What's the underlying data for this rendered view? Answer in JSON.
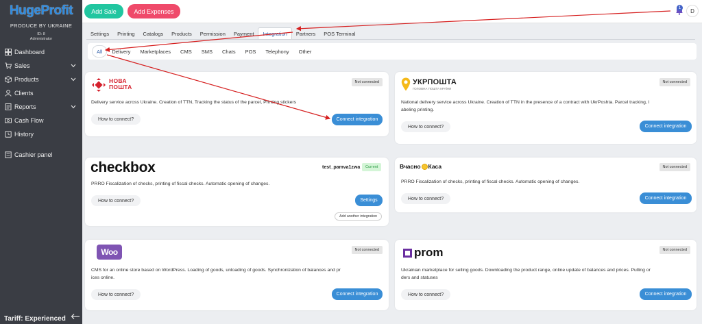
{
  "app": {
    "name": "HugeProfit",
    "tagline": "PRODUCE BY UKRAINE",
    "id_label": "ID: 8",
    "role": "Administrator",
    "tariff": "Tariff: Experienced"
  },
  "sidebar": {
    "items": [
      {
        "label": "Dashboard",
        "icon": "dashboard-icon"
      },
      {
        "label": "Sales",
        "icon": "cart-icon",
        "expandable": true
      },
      {
        "label": "Products",
        "icon": "box-icon",
        "expandable": true
      },
      {
        "label": "Clients",
        "icon": "user-icon"
      },
      {
        "label": "Reports",
        "icon": "report-icon",
        "expandable": true
      },
      {
        "label": "Cash Flow",
        "icon": "cashflow-icon"
      },
      {
        "label": "History",
        "icon": "history-icon"
      },
      {
        "label": "Cashier panel",
        "icon": "cashier-icon"
      }
    ]
  },
  "topbar": {
    "add_sale": "Add Sale",
    "add_expenses": "Add Expenses",
    "notification_count": "1",
    "avatar_letter": "D"
  },
  "tabs": [
    {
      "label": "Settings",
      "active": false
    },
    {
      "label": "Printing",
      "active": false
    },
    {
      "label": "Catalogs",
      "active": false
    },
    {
      "label": "Products",
      "active": false
    },
    {
      "label": "Permission",
      "active": false
    },
    {
      "label": "Payment",
      "active": false
    },
    {
      "label": "Integration",
      "active": true
    },
    {
      "label": "Partners",
      "active": false
    },
    {
      "label": "POS Terminal",
      "active": false
    }
  ],
  "subtabs": [
    {
      "label": "All",
      "active": true
    },
    {
      "label": "Delivery",
      "active": false
    },
    {
      "label": "Marketplaces",
      "active": false
    },
    {
      "label": "CMS",
      "active": false
    },
    {
      "label": "SMS",
      "active": false
    },
    {
      "label": "Chats",
      "active": false
    },
    {
      "label": "POS",
      "active": false
    },
    {
      "label": "Telephony",
      "active": false
    },
    {
      "label": "Other",
      "active": false
    }
  ],
  "cards": {
    "novaposhta": {
      "logo_line1": "НОВА",
      "logo_line2": "ПОШТА",
      "status": "Not connected",
      "desc": "Delivery service across Ukraine. Creation of TTN, Tracking the status of the parcel, Printing stickers",
      "howto": "How to connect?",
      "action": "Connect integration"
    },
    "ukrposhta": {
      "logo_title": "УКРПОШТА",
      "logo_sub": "ГОЛОВНА ПОШТА КРАЇНИ",
      "status": "Not connected",
      "desc_line1": "National delivery service across Ukraine. Creation of TTN in the presence of a contract with UkrPoshta. Parcel tracking, l",
      "desc_line2": "abeling printing.",
      "howto": "How to connect?",
      "action": "Connect integration"
    },
    "checkbox": {
      "logo": "checkbox",
      "shop_name": "test_pamva1zwa",
      "status": "Current",
      "desc": "PRRO Fiscalization of checks, printing of fiscal checks. Automatic opening of changes.",
      "howto": "How to connect?",
      "action": "Settings",
      "secondary": "Add another integration"
    },
    "vchasno": {
      "logo_left": "Вчасно",
      "logo_right": "Каса",
      "status": "Not connected",
      "desc": "PRRO Fiscalization of checks, printing of fiscal checks. Automatic opening of changes.",
      "howto": "How to connect?",
      "action": "Connect integration"
    },
    "woo": {
      "logo": "Woo",
      "status": "Not connected",
      "desc_line1": "CMS for an online store based on WordPress. Loading of goods, unloading of goods. Synchronization of balances and pr",
      "desc_line2": "ices online.",
      "howto": "How to connect?",
      "action": "Connect integration"
    },
    "prom": {
      "logo": "prom",
      "status": "Not connected",
      "desc_line1": "Ukrainian marketplace for selling goods. Downloading the product range, online update of balances and prices. Pulling or",
      "desc_line2": "ders and statuses",
      "howto": "How to connect?",
      "action": "Connect integration"
    }
  },
  "colors": {
    "accent_blue": "#3a8ed6",
    "add_sale_green": "#21c6a0",
    "add_expenses_red": "#ef4a6a",
    "sidebar_bg": "#3a3d44",
    "annotation_red": "#d62020"
  }
}
